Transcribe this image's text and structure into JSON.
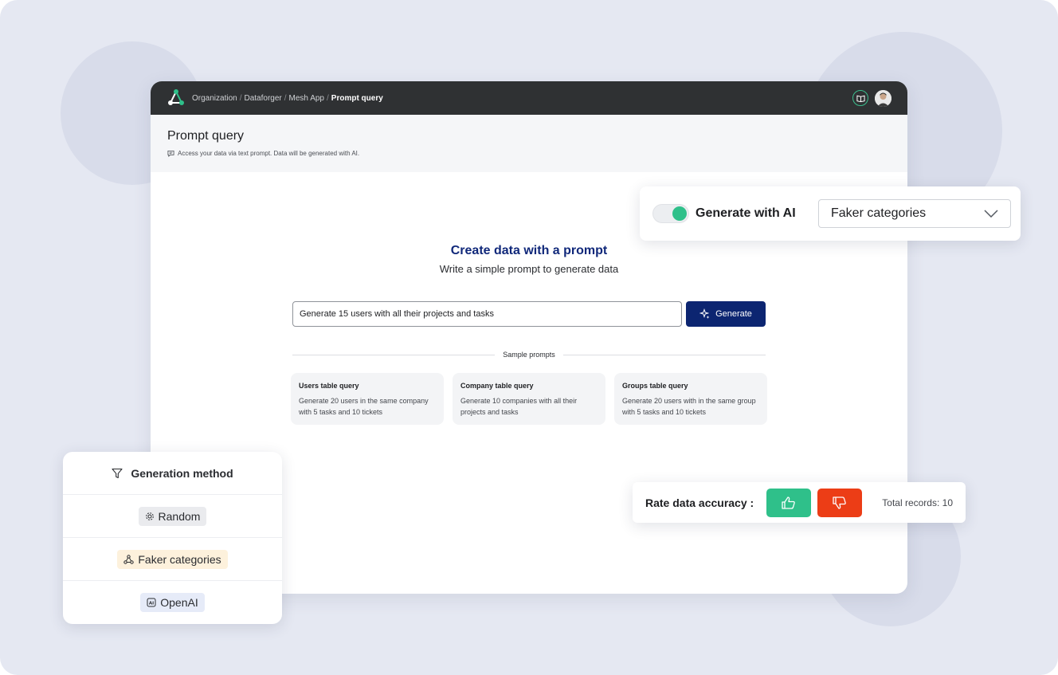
{
  "breadcrumb": [
    "Organization",
    "Dataforger",
    "Mesh App",
    "Prompt query"
  ],
  "breadcrumb_separator": "/",
  "header": {
    "title": "Prompt query",
    "subtitle": "Access your data via text prompt. Data will be generated with AI."
  },
  "main": {
    "title": "Create data with a prompt",
    "subtitle": "Write a simple prompt to generate data",
    "prompt_value": "Generate 15 users with all their projects and tasks",
    "generate_label": "Generate",
    "samples_label": "Sample prompts",
    "samples": [
      {
        "title": "Users table query",
        "desc": "Generate 20 users in the same company with 5 tasks and 10 tickets"
      },
      {
        "title": "Company table query",
        "desc": "Generate 10 companies with all their projects and tasks"
      },
      {
        "title": "Groups table query",
        "desc": "Generate 20 users with in the same group with 5 tasks and 10 tickets"
      }
    ]
  },
  "ai_panel": {
    "toggle_label": "Generate with AI",
    "toggle_on": true,
    "select_value": "Faker categories"
  },
  "rate_panel": {
    "label": "Rate data accuracy :",
    "total": "Total records: 10"
  },
  "method_panel": {
    "title": "Generation method",
    "options": [
      "Random",
      "Faker categories",
      "OpenAI"
    ]
  },
  "colors": {
    "accent_green": "#2fc08a",
    "accent_red": "#ec3d16",
    "primary_navy": "#0c2571",
    "topbar": "#2f3133"
  },
  "icons": {
    "logo": "dataforger-logo-icon",
    "book": "book-open-icon",
    "avatar": "user-avatar",
    "chat": "chat-icon",
    "sparkle": "sparkle-icon",
    "chevron": "chevron-down-icon",
    "thumbs_up": "thumbs-up-icon",
    "thumbs_down": "thumbs-down-icon",
    "filter": "filter-icon",
    "gear": "gear-icon",
    "network": "network-icon",
    "ai": "ai-icon"
  }
}
